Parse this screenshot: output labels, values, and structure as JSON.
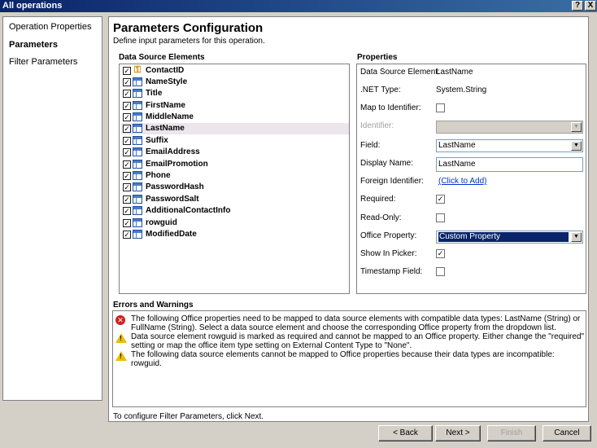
{
  "window": {
    "title": "All operations",
    "help_label": "?",
    "close_label": "X"
  },
  "nav": {
    "items": [
      {
        "label": "Operation Properties",
        "active": false
      },
      {
        "label": "Parameters",
        "active": true
      },
      {
        "label": "Filter Parameters",
        "active": false
      }
    ]
  },
  "page": {
    "title": "Parameters Configuration",
    "subtitle": "Define input parameters for this operation."
  },
  "data_source": {
    "heading": "Data Source Elements",
    "selected": "LastName",
    "items": [
      {
        "name": "ContactID",
        "checked": true,
        "icon": "key-icon"
      },
      {
        "name": "NameStyle",
        "checked": true,
        "icon": "field-icon"
      },
      {
        "name": "Title",
        "checked": true,
        "icon": "field-icon"
      },
      {
        "name": "FirstName",
        "checked": true,
        "icon": "field-icon"
      },
      {
        "name": "MiddleName",
        "checked": true,
        "icon": "field-icon"
      },
      {
        "name": "LastName",
        "checked": true,
        "icon": "field-icon"
      },
      {
        "name": "Suffix",
        "checked": true,
        "icon": "field-icon"
      },
      {
        "name": "EmailAddress",
        "checked": true,
        "icon": "field-icon"
      },
      {
        "name": "EmailPromotion",
        "checked": true,
        "icon": "field-icon"
      },
      {
        "name": "Phone",
        "checked": true,
        "icon": "field-icon"
      },
      {
        "name": "PasswordHash",
        "checked": true,
        "icon": "field-icon"
      },
      {
        "name": "PasswordSalt",
        "checked": true,
        "icon": "field-icon"
      },
      {
        "name": "AdditionalContactInfo",
        "checked": true,
        "icon": "field-icon"
      },
      {
        "name": "rowguid",
        "checked": true,
        "icon": "field-icon"
      },
      {
        "name": "ModifiedDate",
        "checked": true,
        "icon": "field-icon"
      }
    ]
  },
  "properties": {
    "heading": "Properties",
    "data_source_element": {
      "label": "Data Source Element:",
      "value": "LastName"
    },
    "net_type": {
      "label": ".NET Type:",
      "value": "System.String"
    },
    "map_to_identifier": {
      "label": "Map to Identifier:",
      "checked": false
    },
    "identifier": {
      "label": "Identifier:",
      "value": ""
    },
    "field": {
      "label": "Field:",
      "value": "LastName"
    },
    "display_name": {
      "label": "Display Name:",
      "value": "LastName"
    },
    "foreign_identifier": {
      "label": "Foreign Identifier:",
      "link": "(Click to Add)"
    },
    "required": {
      "label": "Required:",
      "checked": true
    },
    "read_only": {
      "label": "Read-Only:",
      "checked": false
    },
    "office_property": {
      "label": "Office Property:",
      "value": "Custom Property"
    },
    "show_in_picker": {
      "label": "Show In Picker:",
      "checked": true
    },
    "timestamp_field": {
      "label": "Timestamp Field:",
      "checked": false
    }
  },
  "errors": {
    "heading": "Errors and Warnings",
    "items": [
      {
        "type": "error",
        "text": "The following Office properties need to be mapped to data source elements with compatible data types: LastName (String) or FullName (String). Select a data source element and choose the corresponding Office property from the dropdown list."
      },
      {
        "type": "warning",
        "text": "Data source element rowguid is marked as required and cannot be mapped to an Office property. Either change the \"required\" setting or map the office item type setting on External Content Type to \"None\"."
      },
      {
        "type": "warning",
        "text": "The following data source elements cannot be mapped to Office properties because their data types are incompatible: rowguid."
      }
    ]
  },
  "footer_hint": "To configure Filter Parameters, click Next.",
  "buttons": {
    "back": "< Back",
    "next": "Next >",
    "finish": "Finish",
    "cancel": "Cancel"
  },
  "check_mark": "✓"
}
